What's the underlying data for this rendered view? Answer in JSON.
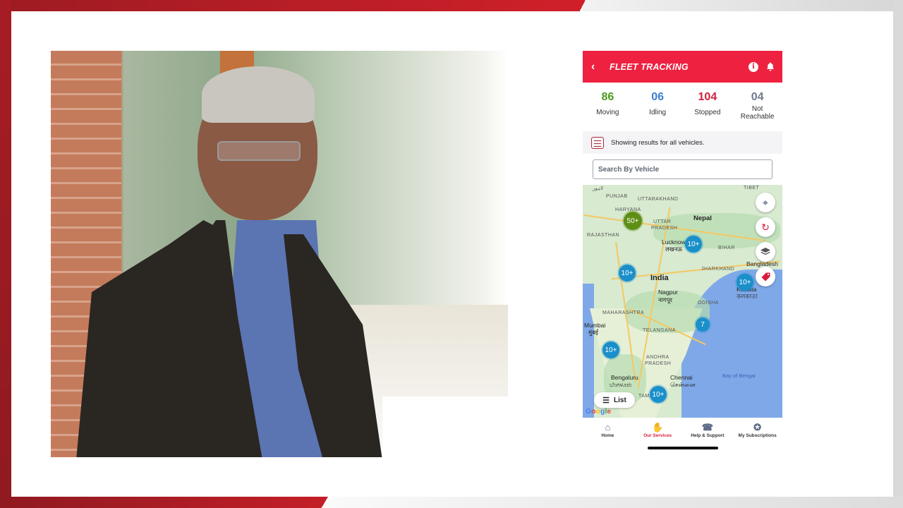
{
  "app": {
    "title": "FLEET TRACKING",
    "back_icon": "chevron-left-icon",
    "header_icons": [
      "info-icon",
      "bell-icon"
    ],
    "accent_color": "#ee2140"
  },
  "stats": [
    {
      "value": "86",
      "label": "Moving",
      "color": "#4a9a1f"
    },
    {
      "value": "06",
      "label": "Idling",
      "color": "#3c7fd0"
    },
    {
      "value": "104",
      "label": "Stopped",
      "color": "#d01f3c"
    },
    {
      "value": "04",
      "label": "Not Reachable",
      "color": "#6f7a8a"
    }
  ],
  "filter": {
    "icon": "filter-sliders-icon",
    "text": "Showing results for all vehicles."
  },
  "search": {
    "placeholder": "Search By Vehicle"
  },
  "map": {
    "labels": {
      "lahore": "لاہور",
      "punjab": "PUNJAB",
      "uttarakhand": "UTTARAKHAND",
      "haryana": "HARYANA",
      "rajasthan": "RAJASTHAN",
      "uttar_pradesh_1": "UTTAR",
      "uttar_pradesh_2": "PRADESH",
      "nepal": "Nepal",
      "lucknow": "Lucknow",
      "lucknow_hi": "लखनऊ",
      "bihar": "BIHAR",
      "bangladesh": "Bangladesh",
      "jharkhand": "JHARKHAND",
      "india": "India",
      "kolkata": "Kolkata",
      "kolkata_bn": "কলকাতা",
      "nagpur": "Nagpur",
      "nagpur_hi": "नागपूर",
      "maharashtra": "MAHARASHTRA",
      "odisha": "ODISHA",
      "mumbai": "Mumbai",
      "mumbai_hi": "मुंबई",
      "telangana": "TELANGANA",
      "andhra_1": "ANDHRA",
      "andhra_2": "PRADESH",
      "bengaluru": "Bengaluru",
      "bengaluru_kn": "ಬೆಂಗಳೂರು",
      "chennai": "Chennai",
      "chennai_ta": "சென்னை",
      "bay_of_bengal": "Bay of Bengal",
      "tamil": "TAMI",
      "tibet": "TIBET"
    },
    "clusters": [
      {
        "label": "50+",
        "type": "large"
      },
      {
        "label": "10+",
        "type": "normal"
      },
      {
        "label": "10+",
        "type": "normal"
      },
      {
        "label": "10+",
        "type": "normal"
      },
      {
        "label": "7",
        "type": "normal"
      },
      {
        "label": "10+",
        "type": "normal"
      },
      {
        "label": "10+",
        "type": "normal"
      }
    ],
    "controls": [
      "locate-icon",
      "refresh-icon",
      "layers-icon",
      "tag-icon"
    ],
    "list_button": "List",
    "attribution": "Google"
  },
  "bottom_nav": [
    {
      "label": "Home",
      "icon": "home-icon",
      "active": false
    },
    {
      "label": "Our Services",
      "icon": "services-icon",
      "active": true
    },
    {
      "label": "Help & Support",
      "icon": "support-phone-icon",
      "active": false
    },
    {
      "label": "My Subscriptions",
      "icon": "subscriptions-icon",
      "active": false
    }
  ]
}
